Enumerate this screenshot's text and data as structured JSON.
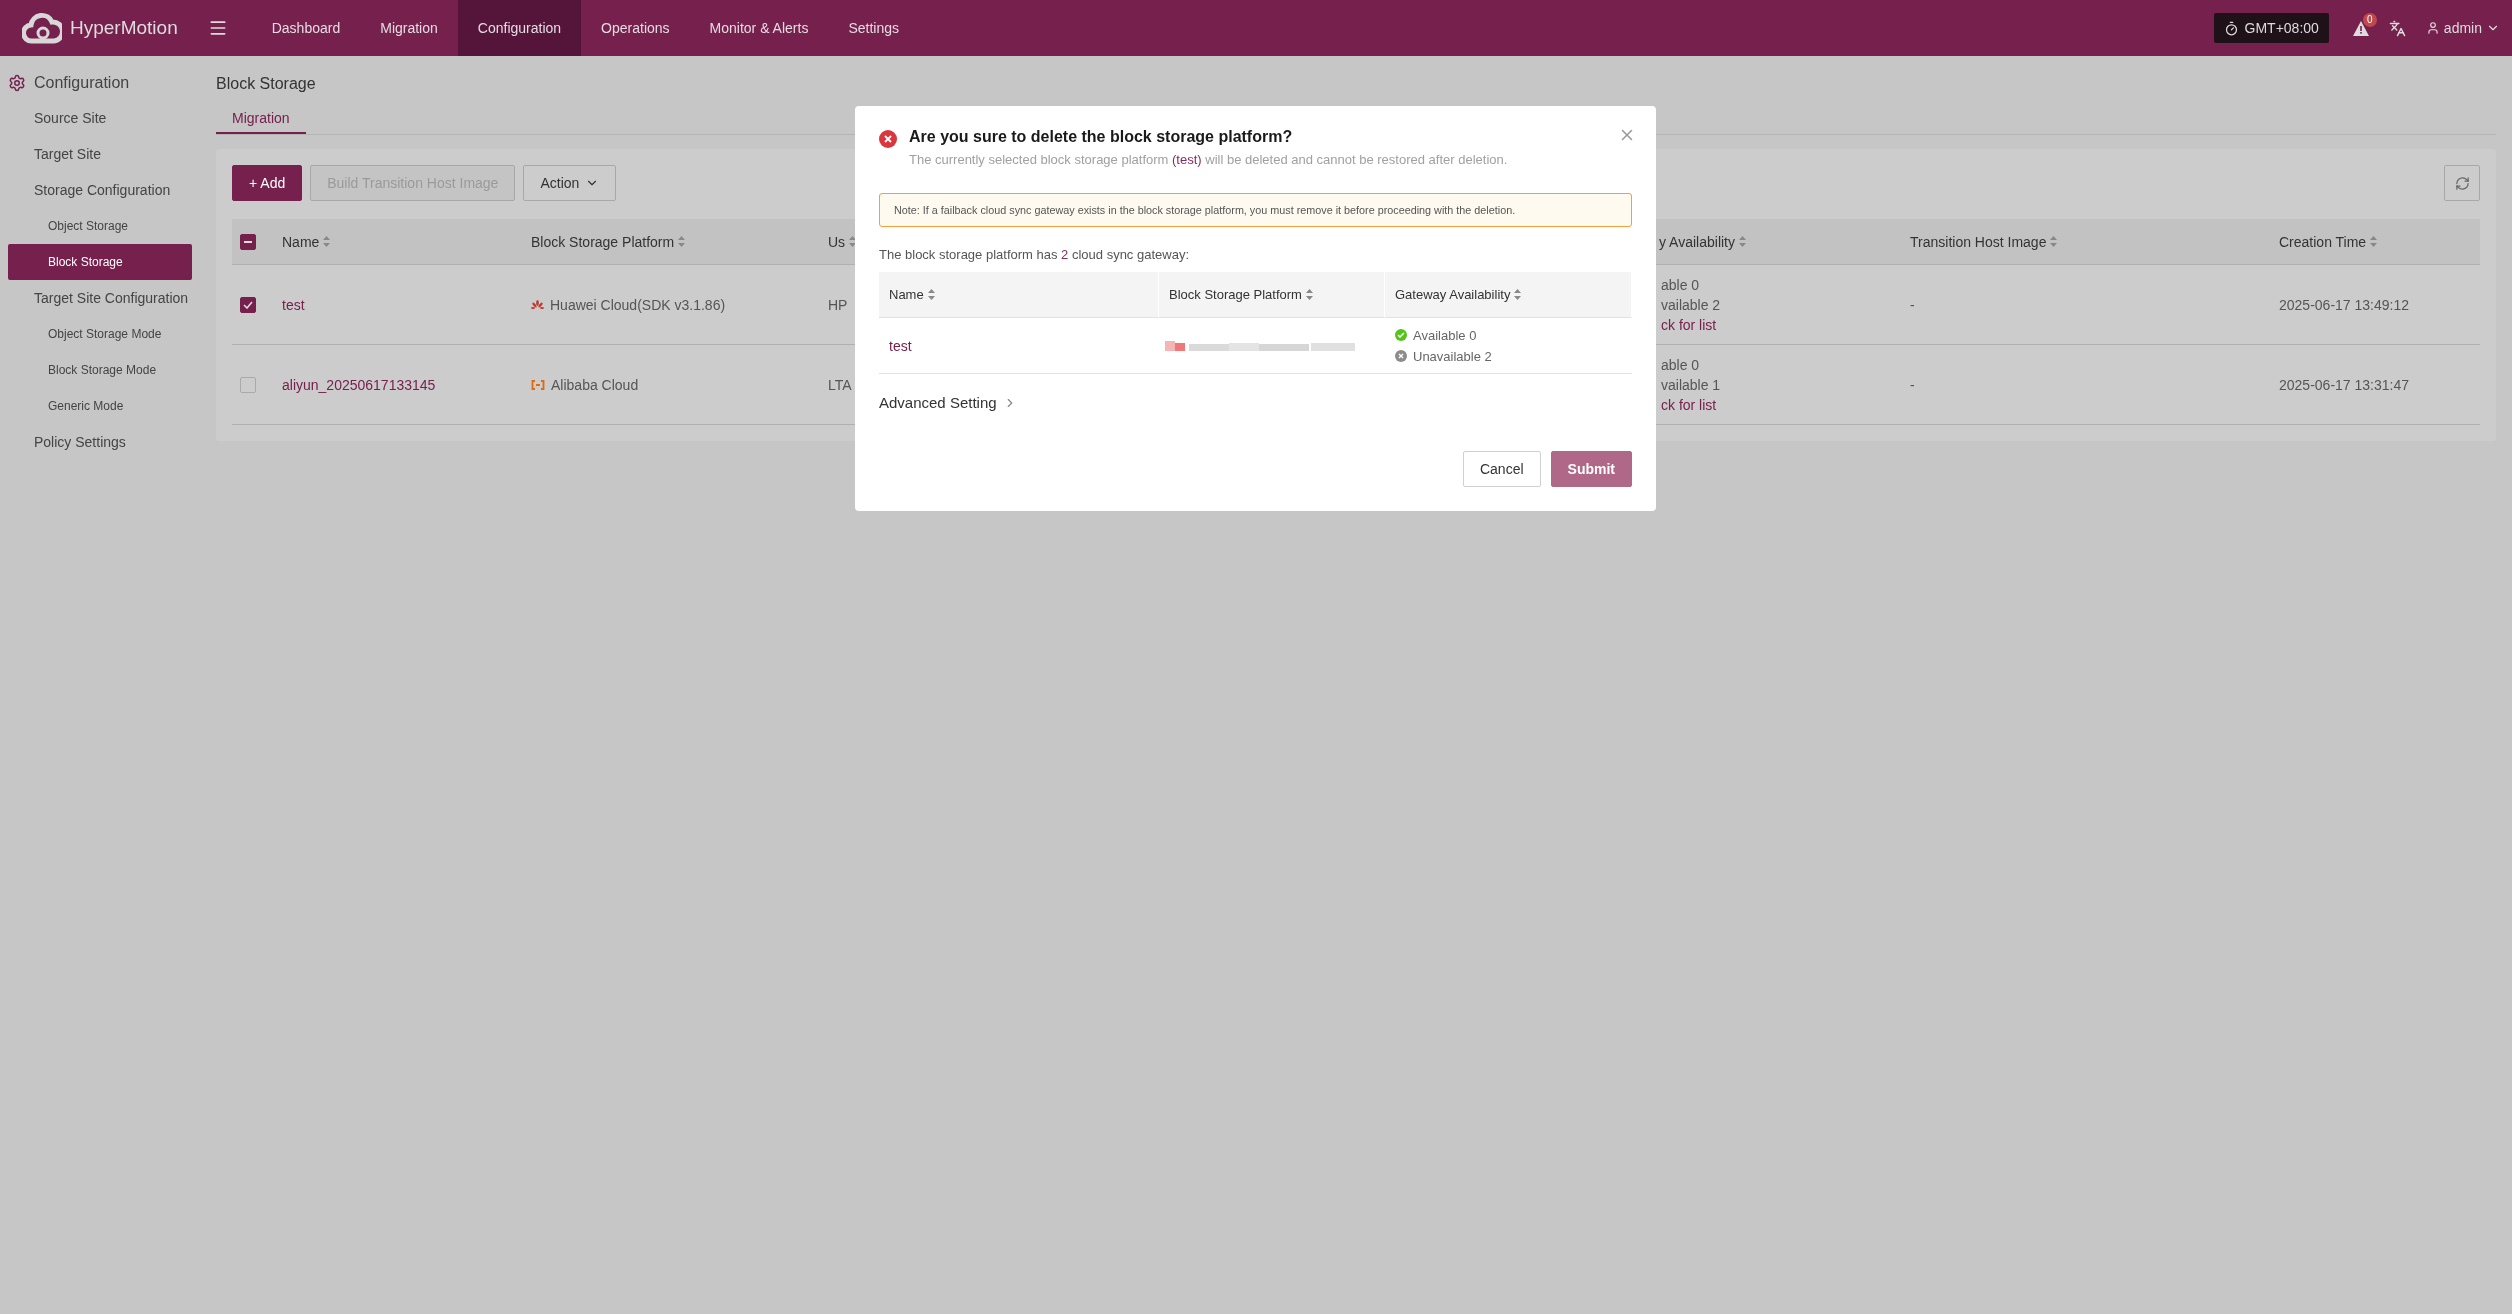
{
  "topbar": {
    "brand": "HyperMotion",
    "nav": [
      {
        "label": "Dashboard",
        "selected": false
      },
      {
        "label": "Migration",
        "selected": false
      },
      {
        "label": "Configuration",
        "selected": true
      },
      {
        "label": "Operations",
        "selected": false
      },
      {
        "label": "Monitor & Alerts",
        "selected": false
      },
      {
        "label": "Settings",
        "selected": false
      }
    ],
    "timezone": "GMT+08:00",
    "alert_count": "0",
    "user": "admin"
  },
  "sidebar": {
    "title": "Configuration",
    "items": [
      {
        "label": "Source Site",
        "selected": false
      },
      {
        "label": "Target Site",
        "selected": false
      },
      {
        "label": "Storage Configuration",
        "selected": false,
        "children": [
          {
            "label": "Object Storage",
            "selected": false
          },
          {
            "label": "Block Storage",
            "selected": true
          }
        ]
      },
      {
        "label": "Target Site Configuration",
        "selected": false,
        "children": [
          {
            "label": "Object Storage Mode",
            "selected": false
          },
          {
            "label": "Block Storage Mode",
            "selected": false
          },
          {
            "label": "Generic Mode",
            "selected": false
          }
        ]
      },
      {
        "label": "Policy Settings",
        "selected": false
      }
    ]
  },
  "page": {
    "title": "Block Storage",
    "tabs": [
      {
        "label": "Migration",
        "selected": true
      }
    ]
  },
  "toolbar": {
    "buttons": [
      {
        "label": "+ Add",
        "kind": "primary",
        "disabled": false
      },
      {
        "label": "Build Transition Host Image",
        "kind": "default",
        "disabled": true
      },
      {
        "label": "Action",
        "kind": "dropdown",
        "disabled": false
      }
    ]
  },
  "table": {
    "select_all_partial": true,
    "columns": [
      "Name",
      "Block Storage Platform",
      "Us",
      "y Availability",
      "Transition Host Image",
      "Creation Time"
    ],
    "rows": [
      {
        "checked": true,
        "name": "test",
        "platform": {
          "label": "Huawei Cloud(SDK v3.1.86)",
          "kind": "huawei"
        },
        "column_3": "HP",
        "availability": [
          "able 0",
          "vailable 2"
        ],
        "list_link": "ck for list",
        "transition_image": "-",
        "creation_time": "2025-06-17 13:49:12"
      },
      {
        "checked": false,
        "name": "aliyun_20250617133145",
        "platform": {
          "label": "Alibaba Cloud",
          "kind": "alibaba"
        },
        "column_3": "LTA",
        "availability": [
          "able 0",
          "vailable 1"
        ],
        "list_link": "ck for list",
        "transition_image": "-",
        "creation_time": "2025-06-17 13:31:47"
      }
    ]
  },
  "dialog": {
    "title": "Are you sure to delete the block storage platform?",
    "message": [
      {
        "text": "The currently selected block storage platform ",
        "highlight": false
      },
      {
        "text": "(test)",
        "highlight": true
      },
      {
        "text": " will be deleted and cannot be restored after deletion.",
        "highlight": false
      }
    ],
    "note": "Note: If a failback cloud sync gateway exists in the block storage platform, you must remove it before proceeding with the deletion.",
    "count_line": [
      {
        "text": "The block storage platform has ",
        "highlight": false
      },
      {
        "text": "2",
        "highlight": true
      },
      {
        "text": " cloud sync gateway:",
        "highlight": false
      }
    ],
    "columns": [
      "Name",
      "Block Storage Platform",
      "Gateway Availability"
    ],
    "rows": [
      {
        "name": "test",
        "platform": {
          "kind": "picture"
        },
        "availability": [
          {
            "label": "Available 0",
            "kind": "ok"
          },
          {
            "label": "Unavailable 2",
            "kind": "fail"
          }
        ]
      }
    ],
    "advanced": "Advanced Setting",
    "buttons": [
      {
        "label": "Cancel",
        "kind": "default"
      },
      {
        "label": "Submit",
        "kind": "primary"
      }
    ]
  }
}
